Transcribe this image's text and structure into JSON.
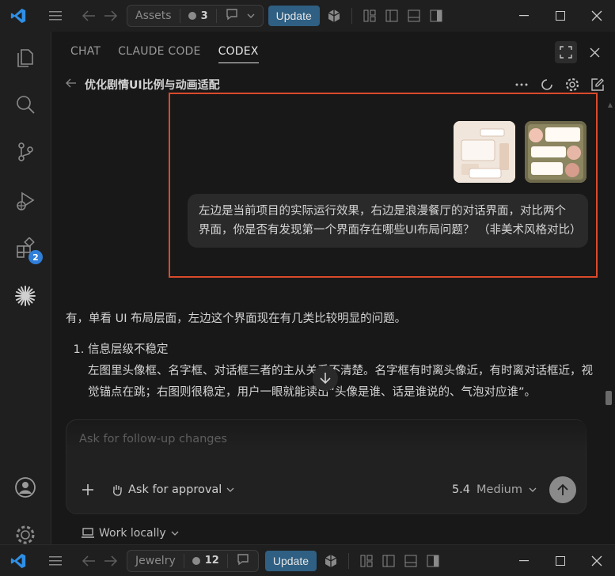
{
  "titlebar_top": {
    "workspace": "Assets",
    "changes_count": "3",
    "update_label": "Update"
  },
  "titlebar_bottom": {
    "workspace": "Jewelry",
    "changes_count": "12",
    "update_label": "Update"
  },
  "activity": {
    "extensions_badge": "2"
  },
  "panel": {
    "tabs": [
      {
        "label": "CHAT"
      },
      {
        "label": "CLAUDE CODE"
      },
      {
        "label": "CODEX"
      }
    ],
    "active_tab": "CODEX",
    "conversation_title": "优化剧情UI比例与动画适配"
  },
  "user_message": {
    "text": "左边是当前项目的实际运行效果，右边是浪漫餐厅的对话界面，对比两个界面，你是否有发现第一个界面存在哪些UI布局问题？ （非美术风格对比）"
  },
  "assistant_message": {
    "intro": "有，单看 UI 布局层面，左边这个界面现在有几类比较明显的问题。",
    "items": [
      {
        "title": "信息层级不稳定",
        "body": "左图里头像框、名字框、对话框三者的主从关系不清楚。名字框有时离头像近，有时离对话框近，视觉锚点在跳；右图则很稳定，用户一眼就能读出“头像是谁、话是谁说的、气泡对应谁”。"
      }
    ]
  },
  "composer": {
    "placeholder": "Ask for follow-up changes",
    "approval_label": "Ask for approval",
    "model_label": "5.4",
    "effort_label": "Medium",
    "work_mode": "Work locally"
  },
  "colors": {
    "accent_update": "#2f5f82",
    "highlight_border": "#d94a2b",
    "badge": "#2f7ed8"
  }
}
